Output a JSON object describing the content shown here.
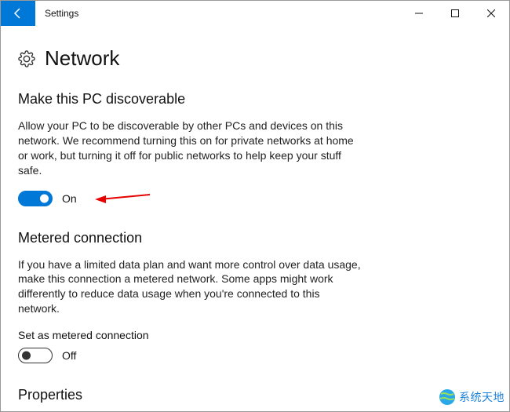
{
  "window": {
    "title": "Settings"
  },
  "page": {
    "title": "Network"
  },
  "sections": {
    "discoverable": {
      "title": "Make this PC discoverable",
      "desc": "Allow your PC to be discoverable by other PCs and devices on this network. We recommend turning this on for private networks at home or work, but turning it off for public networks to help keep your stuff safe.",
      "toggle_label": "On",
      "toggle_state": true
    },
    "metered": {
      "title": "Metered connection",
      "desc": "If you have a limited data plan and want more control over data usage, make this connection a metered network. Some apps might work differently to reduce data usage when you're connected to this network.",
      "sub_label": "Set as metered connection",
      "toggle_label": "Off",
      "toggle_state": false
    },
    "properties": {
      "title": "Properties"
    }
  },
  "watermark": {
    "text": "系统天地"
  }
}
